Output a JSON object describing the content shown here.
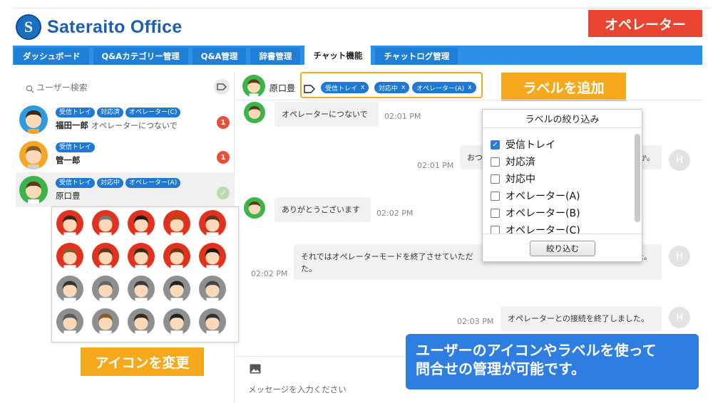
{
  "header": {
    "logo_text": "Sateraito Office",
    "role_badge": "オペレーター"
  },
  "nav": {
    "tabs": [
      {
        "label": "ダッシュボード",
        "active": false
      },
      {
        "label": "Q&Aカテゴリー管理",
        "active": false
      },
      {
        "label": "Q&A管理",
        "active": false
      },
      {
        "label": "辞書管理",
        "active": false
      },
      {
        "label": "チャット機能",
        "active": true
      },
      {
        "label": "チャットログ管理",
        "active": false
      }
    ]
  },
  "sidebar": {
    "search_placeholder": "ユーザー検索",
    "users": [
      {
        "tags": [
          "受信トレイ",
          "対応済",
          "オペレーター(C)"
        ],
        "name": "福田一郎",
        "last_message": "オペレーターにつないで",
        "unread": "1"
      },
      {
        "tags": [
          "受信トレイ"
        ],
        "name": "管一郎",
        "last_message": "",
        "unread": "1"
      },
      {
        "tags": [
          "受信トレイ",
          "対応中",
          "オペレーター(A)"
        ],
        "name": "原口豊",
        "last_message": "",
        "status": "✓"
      }
    ]
  },
  "callouts": {
    "icon_change": "アイコンを変更",
    "add_label": "ラベルを追加"
  },
  "chat": {
    "user_name": "原口豊",
    "labels": [
      {
        "text": "受信トレイ",
        "remove": "x"
      },
      {
        "text": "対応中",
        "remove": "x"
      },
      {
        "text": "オペレーター(A)",
        "remove": "x"
      }
    ],
    "messages": [
      {
        "side": "user",
        "text": "オペレーターにつないで",
        "time": "02:01 PM"
      },
      {
        "side": "operator",
        "text": "おつ",
        "text_tail": "か。",
        "time": "02:01 PM",
        "avatar": "H"
      },
      {
        "side": "user",
        "text": "ありがとうございます",
        "time": "02:02 PM"
      },
      {
        "side": "operator",
        "text": "それではオペレーターモードを終了させていただ",
        "text_tail": "した。",
        "text_line2": "た。",
        "time": "02:02 PM",
        "avatar": "H"
      },
      {
        "side": "operator",
        "text": "オペレーターとの接続を終了しました。",
        "time": "02:03 PM",
        "avatar": "H"
      }
    ],
    "input_placeholder": "メッセージを入力ください"
  },
  "filter_popup": {
    "title": "ラベルの絞り込み",
    "options": [
      {
        "label": "受信トレイ",
        "checked": true
      },
      {
        "label": "対応済",
        "checked": false
      },
      {
        "label": "対応中",
        "checked": false
      },
      {
        "label": "オペレーター(A)",
        "checked": false
      },
      {
        "label": "オペレーター(B)",
        "checked": false
      },
      {
        "label": "オペレーター(C)",
        "checked": false
      }
    ],
    "button": "絞り込む"
  },
  "info_box": {
    "line1": "ユーザーのアイコンやラベルを使って",
    "line2": "問合せの管理が可能です。"
  },
  "colors": {
    "brand_blue": "#2b91e8",
    "tag_blue": "#1e78d4",
    "badge_red": "#e8442f",
    "callout_orange": "#f5a81c",
    "info_blue": "#2e7de0"
  }
}
